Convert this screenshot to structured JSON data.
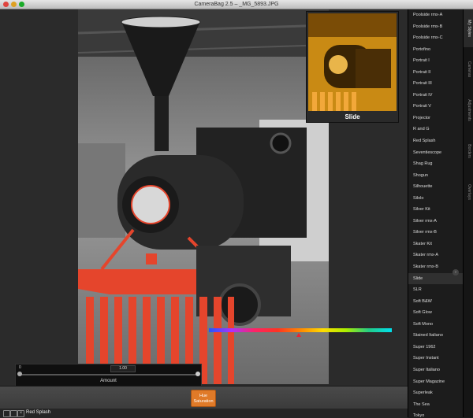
{
  "window": {
    "title": "CameraBag 2.5 – _MG_5893.JPG"
  },
  "preview": {
    "label": "Slide"
  },
  "amount_slider": {
    "min_label": "0",
    "value": "1.00",
    "label": "Amount"
  },
  "adjustment_button": {
    "label": "Hue Saturation"
  },
  "layer": {
    "name": "Red Splash"
  },
  "styles": {
    "items": [
      "Poolside rmx-A",
      "Poolside rmx-B",
      "Poolside rmx-C",
      "Portofino",
      "Portrait I",
      "Portrait II",
      "Portrait III",
      "Portrait IV",
      "Portrait V",
      "Projector",
      "R and G",
      "Red Splash",
      "Seventiescope",
      "Shag Rug",
      "Shogun",
      "Silhouette",
      "Silolo",
      "Silver Kit",
      "Silver rmx-A",
      "Silver rmx-B",
      "Skater Kit",
      "Skater rmx-A",
      "Skater rmx-B",
      "Slide",
      "SLR",
      "Soft B&W",
      "Soft Glow",
      "Soft Mono",
      "Stained Italiano",
      "Super 1962",
      "Super Instant",
      "Super Italiano",
      "Super Magazine",
      "Superleak",
      "The Sea",
      "Tokyo"
    ],
    "selected": "Slide"
  },
  "tabs": [
    "My Styles",
    "Cameras",
    "Adjustments",
    "Borders",
    "Overlays"
  ],
  "colors": {
    "accent": "#e07a28",
    "splash": "#e5452c"
  }
}
